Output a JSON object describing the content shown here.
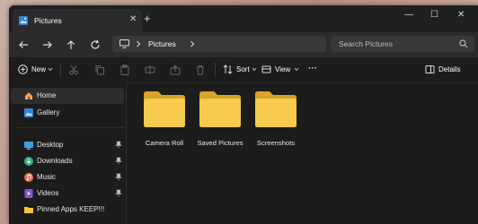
{
  "window": {
    "tab_title": "Pictures",
    "tab_close": "✕",
    "new_tab": "+",
    "minimize": "—",
    "maximize": "☐",
    "close": "✕"
  },
  "address": {
    "location_icon": "monitor-icon",
    "breadcrumb": [
      "Pictures"
    ],
    "search_placeholder": "Search Pictures"
  },
  "toolbar": {
    "new_label": "New",
    "sort_label": "Sort",
    "view_label": "View",
    "more_label": "···",
    "details_label": "Details"
  },
  "sidebar": {
    "items": [
      {
        "label": "Home",
        "icon": "home-icon",
        "selected": true
      },
      {
        "label": "Gallery",
        "icon": "gallery-icon"
      },
      {
        "label": "Desktop",
        "icon": "desktop-icon",
        "pinned": true
      },
      {
        "label": "Downloads",
        "icon": "downloads-icon",
        "pinned": true
      },
      {
        "label": "Music",
        "icon": "music-icon",
        "pinned": true
      },
      {
        "label": "Videos",
        "icon": "videos-icon",
        "pinned": true
      },
      {
        "label": "Pinned Apps KEEP!!!",
        "icon": "folder-icon"
      }
    ]
  },
  "content": {
    "folders": [
      "Camera Roll",
      "Saved Pictures",
      "Screenshots"
    ]
  },
  "colors": {
    "window_bg": "#1c1c1c",
    "folder_yellow": "#f4c542",
    "accent_blue": "#3a8ee6"
  }
}
